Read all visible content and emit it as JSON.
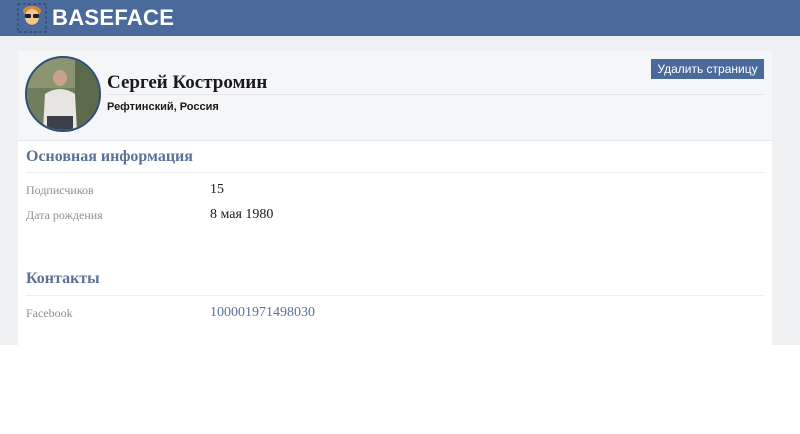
{
  "header": {
    "logo_text": "BASEFACE",
    "logo_icon": "bearded-face-icon",
    "brand_color": "#4a6a9c"
  },
  "profile": {
    "name": "Сергей Костромин",
    "location": "Рефтинский, Россия",
    "delete_label": "Удалить страницу"
  },
  "main_info": {
    "title": "Основная информация",
    "fields": [
      {
        "label": "Подписчиков",
        "value": "15"
      },
      {
        "label": "Дата рождения",
        "value": "8 мая 1980"
      }
    ]
  },
  "contacts": {
    "title": "Контакты",
    "fields": [
      {
        "label": "Facebook",
        "value": "100001971498030"
      }
    ]
  }
}
